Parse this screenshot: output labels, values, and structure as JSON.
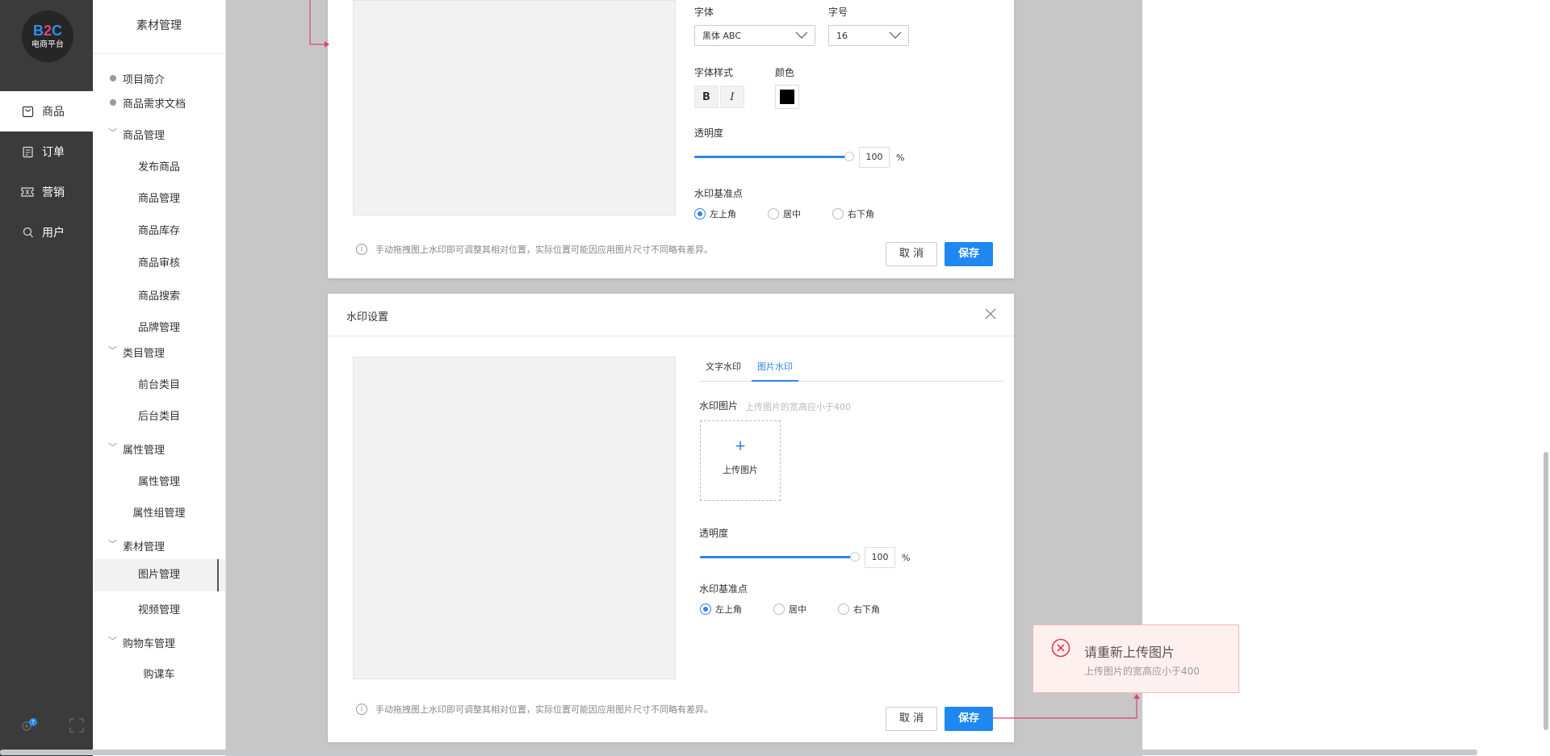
{
  "logo": {
    "line1_b": "B",
    "line1_2": "2",
    "line1_c": "C",
    "line2": "电商平台"
  },
  "nav": {
    "items": [
      {
        "label": "商品",
        "icon": "bag-icon"
      },
      {
        "label": "订单",
        "icon": "order-icon"
      },
      {
        "label": "营销",
        "icon": "ticket-icon"
      },
      {
        "label": "用户",
        "icon": "user-icon"
      }
    ],
    "badge": "?"
  },
  "submenu": {
    "title": "素材管理",
    "doc_items": [
      "项目简介",
      "商品需求文档"
    ],
    "groups": [
      {
        "label": "商品管理",
        "children": [
          "发布商品",
          "商品管理",
          "商品库存",
          "商品审核",
          "商品搜索",
          "品牌管理"
        ]
      },
      {
        "label": "类目管理",
        "children": [
          "前台类目",
          "后台类目"
        ]
      },
      {
        "label": "属性管理",
        "children": [
          "属性管理",
          "属性组管理"
        ]
      },
      {
        "label": "素材管理",
        "children": [
          "图片管理",
          "视频管理"
        ]
      },
      {
        "label": "购物车管理",
        "children": [
          "购课车"
        ]
      }
    ],
    "active_item": "图片管理"
  },
  "dialog1": {
    "font_label": "字体",
    "font_value": "黑体 ABC",
    "size_label": "字号",
    "size_value": "16",
    "style_label": "字体样式",
    "bold_label": "B",
    "italic_label": "I",
    "color_label": "颜色",
    "color_value": "#000000",
    "opacity_label": "透明度",
    "opacity_value": "100",
    "opacity_fraction": 1.0,
    "percent": "%",
    "anchor_label": "水印基准点",
    "anchor_options": [
      "左上角",
      "居中",
      "右下角"
    ],
    "anchor_selected": "左上角",
    "note": "手动拖拽图上水印即可调整其相对位置，实际位置可能因应用图片尺寸不同略有差异。",
    "cancel": "取 消",
    "save": "保存"
  },
  "dialog2": {
    "title": "水印设置",
    "tabs": [
      "文字水印",
      "图片水印"
    ],
    "active_tab": "图片水印",
    "image_label": "水印图片",
    "image_hint": "上传图片的宽高应小于400",
    "upload_plus": "+",
    "upload_label": "上传图片",
    "opacity_label": "透明度",
    "opacity_value": "100",
    "opacity_fraction": 1.0,
    "percent": "%",
    "anchor_label": "水印基准点",
    "anchor_options": [
      "左上角",
      "居中",
      "右下角"
    ],
    "anchor_selected": "左上角",
    "note": "手动拖拽图上水印即可调整其相对位置，实际位置可能因应用图片尺寸不同略有差异。",
    "cancel": "取 消",
    "save": "保存"
  },
  "toast": {
    "title": "请重新上传图片",
    "message": "上传图片的宽高应小于400",
    "accent": "#e8384f"
  },
  "colors": {
    "primary": "#1e88f0",
    "annotation": "#e0407a",
    "sidebar": "#3b3b3b"
  }
}
